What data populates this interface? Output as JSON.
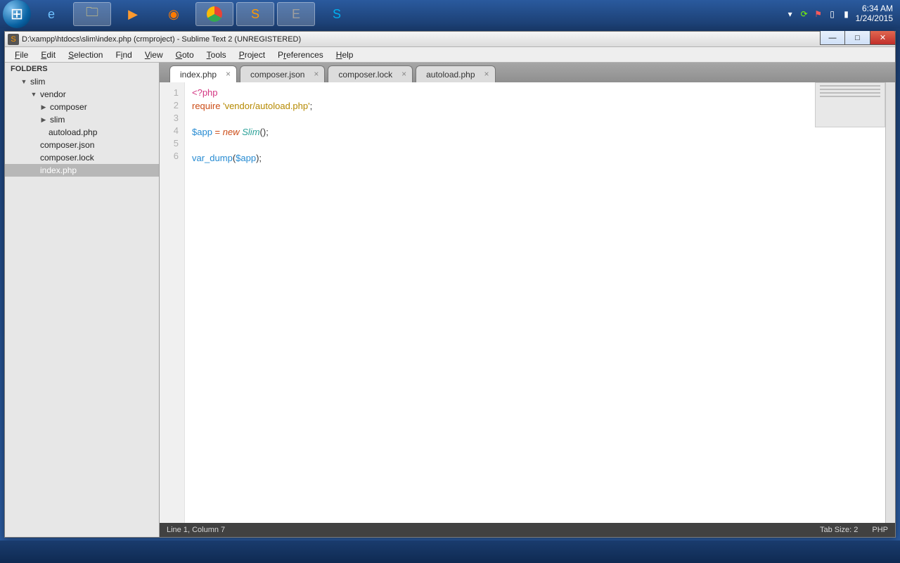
{
  "taskbar": {
    "apps": [
      "start",
      "ie",
      "explorer",
      "mediaplayer",
      "firefox",
      "chrome",
      "sublime",
      "evernote",
      "skype"
    ],
    "tray": {
      "time": "6:34 AM",
      "date": "1/24/2015"
    }
  },
  "window": {
    "title": "D:\\xampp\\htdocs\\slim\\index.php (crmproject) - Sublime Text 2 (UNREGISTERED)",
    "controls": {
      "min": "—",
      "max": "□",
      "close": "✕"
    }
  },
  "menubar": {
    "file": "File",
    "edit": "Edit",
    "selection": "Selection",
    "find": "Find",
    "view": "View",
    "goto": "Goto",
    "tools": "Tools",
    "project": "Project",
    "preferences": "Preferences",
    "help": "Help"
  },
  "sidebar": {
    "header": "FOLDERS",
    "tree": {
      "slim": {
        "label": "slim",
        "vendor": {
          "label": "vendor",
          "composer": "composer",
          "slim": "slim",
          "autoload": "autoload.php"
        },
        "composer_json": "composer.json",
        "composer_lock": "composer.lock",
        "index_php": "index.php"
      }
    }
  },
  "tabs": {
    "t0": "index.php",
    "t1": "composer.json",
    "t2": "composer.lock",
    "t3": "autoload.php",
    "close": "×"
  },
  "code": {
    "gutter": {
      "l1": "1",
      "l2": "2",
      "l3": "3",
      "l4": "4",
      "l5": "5",
      "l6": "6"
    },
    "l1": {
      "open": "<?php"
    },
    "l2": {
      "kw": "require",
      "sp": " ",
      "str": "'vendor/autoload.php'",
      "semi": ";"
    },
    "l4": {
      "var": "$app",
      "sp1": " ",
      "eq": "=",
      "sp2": " ",
      "new": "new",
      "sp3": " ",
      "cls": "Slim",
      "paren": "()",
      "semi": ";"
    },
    "l6": {
      "fn": "var_dump",
      "open": "(",
      "var": "$app",
      "close": ")",
      "semi": ";"
    }
  },
  "status": {
    "left": "Line 1, Column 7",
    "tab": "Tab Size: 2",
    "lang": "PHP"
  }
}
